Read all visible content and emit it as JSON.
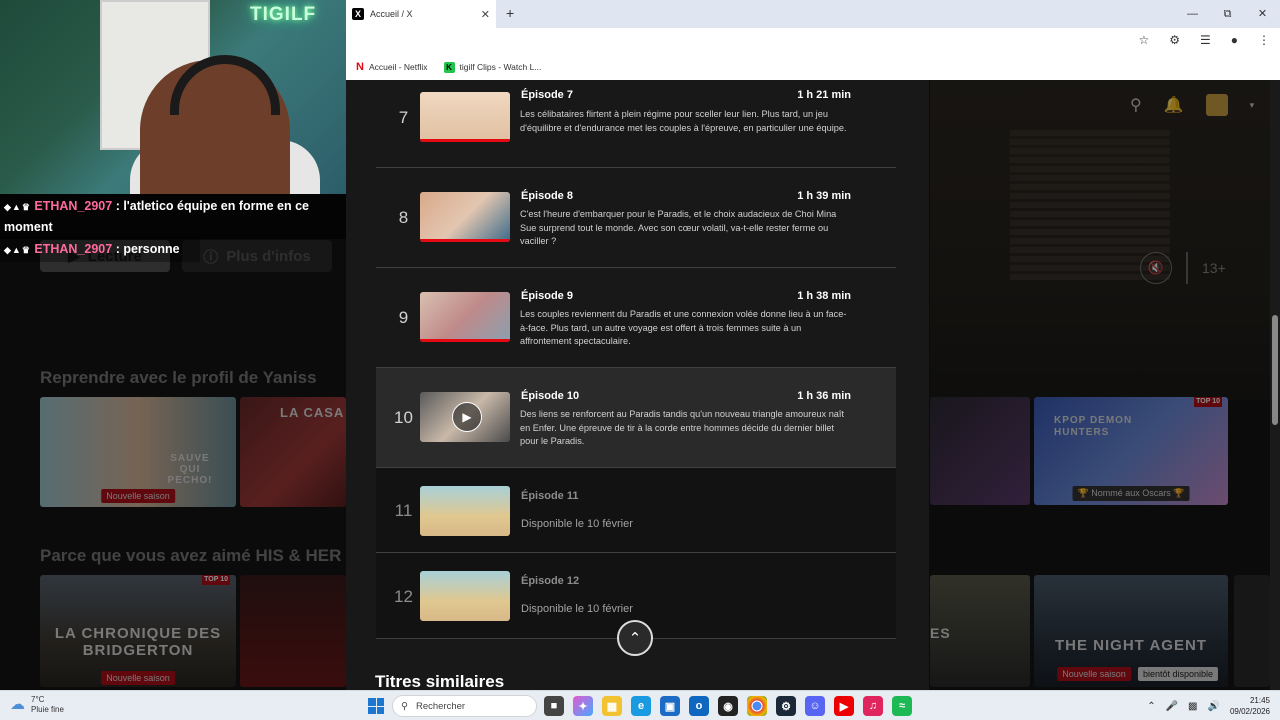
{
  "browser": {
    "tab_title": "Accueil / X",
    "tab_close": "✕",
    "new_tab": "+",
    "bookmarks": [
      {
        "label": "Accueil - Netflix",
        "icon": "netflix-icon"
      },
      {
        "label": "tigilf Clips - Watch L...",
        "icon": "kick-icon"
      }
    ]
  },
  "stream": {
    "neon_sign": "TIGILF",
    "chat": [
      {
        "user": "ETHAN_2907",
        "message": " : l'atletico équipe en forme en ce moment"
      },
      {
        "user": "ETHAN_2907",
        "message": " : personne"
      }
    ]
  },
  "netflix_bg": {
    "play_label": "Lecture",
    "info_label": "Plus d'infos",
    "age_rating": "13+",
    "row1_title": "Reprendre avec le profil de Yaniss",
    "row2_title": "Parce que vous avez aimé HIS & HER",
    "tile_sauve": "SAUVE QUI PECHO!",
    "tile_casa": "LA CASA",
    "badge_new_season": "Nouvelle saison",
    "tile_kpop": "KPOP DEMON HUNTERS",
    "badge_oscars": "🏆 Nommé aux Oscars 🏆",
    "tile_bridgerton": "LA CHRONIQUE DES BRIDGERTON",
    "tile_night_agent": "THE NIGHT AGENT",
    "badge_soon": "bientôt disponible",
    "top10": "TOP 10",
    "tile_es": "ES"
  },
  "episodes": [
    {
      "num": "7",
      "title": "Épisode 7",
      "duration": "1 h 21 min",
      "desc": "Les célibataires flirtent à plein régime pour sceller leur lien. Plus tard, un jeu d'équilibre et d'endurance met les couples à l'épreuve, en particulier une équipe.",
      "progress": 1.0
    },
    {
      "num": "8",
      "title": "Épisode 8",
      "duration": "1 h 39 min",
      "desc": "C'est l'heure d'embarquer pour le Paradis, et le choix audacieux de Choi Mina Sue surprend tout le monde. Avec son cœur volatil, va-t-elle rester ferme ou vaciller ?",
      "progress": 1.0
    },
    {
      "num": "9",
      "title": "Épisode 9",
      "duration": "1 h 38 min",
      "desc": "Les couples reviennent du Paradis et une connexion volée donne lieu à un face-à-face. Plus tard, un autre voyage est offert à trois femmes suite à un affrontement spectaculaire.",
      "progress": 1.0
    },
    {
      "num": "10",
      "title": "Épisode 10",
      "duration": "1 h 36 min",
      "desc": "Des liens se renforcent au Paradis tandis qu'un nouveau triangle amoureux naît en Enfer. Une épreuve de tir à la corde entre hommes décide du dernier billet pour le Paradis.",
      "progress": 0
    }
  ],
  "locked_episodes": [
    {
      "num": "11",
      "title": "Épisode 11",
      "availability": "Disponible le 10 février"
    },
    {
      "num": "12",
      "title": "Épisode 12",
      "availability": "Disponible le 10 février"
    }
  ],
  "similar_title": "Titres similaires",
  "taskbar": {
    "temperature": "7°C",
    "weather": "Pluie fine",
    "search_placeholder": "Rechercher",
    "time": "21:45",
    "date": "09/02/2026"
  },
  "colors": {
    "netflix_red": "#e50914",
    "modal_bg": "#181818"
  }
}
